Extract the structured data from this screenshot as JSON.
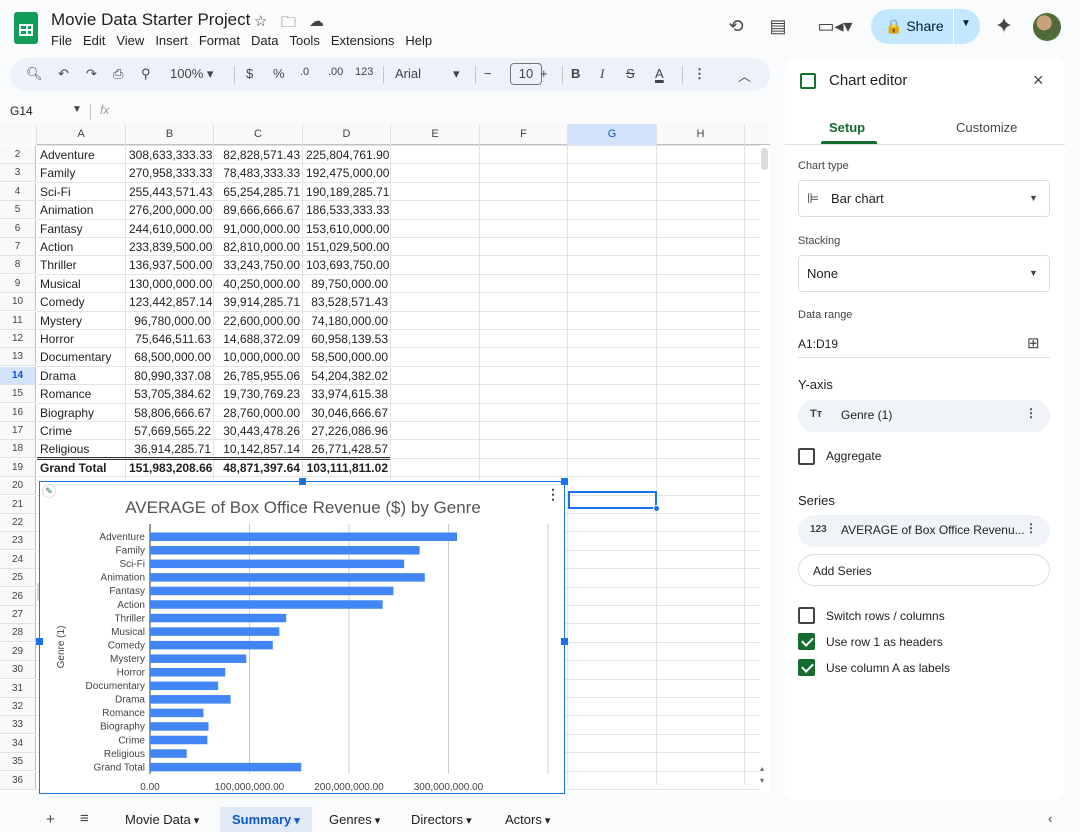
{
  "app": {
    "doc_title": "Movie Data Starter Project",
    "menu": [
      "File",
      "Edit",
      "View",
      "Insert",
      "Format",
      "Data",
      "Tools",
      "Extensions",
      "Help"
    ],
    "share_label": "Share"
  },
  "toolbar": {
    "zoom": "100%",
    "currency": "$",
    "percent": "%",
    "dec_dec": ".0",
    "dec_inc": ".00",
    "format_num": "123",
    "font": "Arial",
    "font_size": "10",
    "bold": "B",
    "italic": "I",
    "underline_a": "A"
  },
  "formula_bar": {
    "name_box": "G14",
    "fx": "fx"
  },
  "grid": {
    "columns": [
      "A",
      "B",
      "C",
      "D",
      "E",
      "F",
      "G",
      "H"
    ],
    "rows": [
      {
        "n": "2",
        "a": "Adventure",
        "b": "308,633,333.33",
        "c": "82,828,571.43",
        "d": "225,804,761.90"
      },
      {
        "n": "3",
        "a": "Family",
        "b": "270,958,333.33",
        "c": "78,483,333.33",
        "d": "192,475,000.00"
      },
      {
        "n": "4",
        "a": "Sci-Fi",
        "b": "255,443,571.43",
        "c": "65,254,285.71",
        "d": "190,189,285.71"
      },
      {
        "n": "5",
        "a": "Animation",
        "b": "276,200,000.00",
        "c": "89,666,666.67",
        "d": "186,533,333.33"
      },
      {
        "n": "6",
        "a": "Fantasy",
        "b": "244,610,000.00",
        "c": "91,000,000.00",
        "d": "153,610,000.00"
      },
      {
        "n": "7",
        "a": "Action",
        "b": "233,839,500.00",
        "c": "82,810,000.00",
        "d": "151,029,500.00"
      },
      {
        "n": "8",
        "a": "Thriller",
        "b": "136,937,500.00",
        "c": "33,243,750.00",
        "d": "103,693,750.00"
      },
      {
        "n": "9",
        "a": "Musical",
        "b": "130,000,000.00",
        "c": "40,250,000.00",
        "d": "89,750,000.00"
      },
      {
        "n": "10",
        "a": "Comedy",
        "b": "123,442,857.14",
        "c": "39,914,285.71",
        "d": "83,528,571.43"
      },
      {
        "n": "11",
        "a": "Mystery",
        "b": "96,780,000.00",
        "c": "22,600,000.00",
        "d": "74,180,000.00"
      },
      {
        "n": "12",
        "a": "Horror",
        "b": "75,646,511.63",
        "c": "14,688,372.09",
        "d": "60,958,139.53"
      },
      {
        "n": "13",
        "a": "Documentary",
        "b": "68,500,000.00",
        "c": "10,000,000.00",
        "d": "58,500,000.00"
      },
      {
        "n": "14",
        "a": "Drama",
        "b": "80,990,337.08",
        "c": "26,785,955.06",
        "d": "54,204,382.02"
      },
      {
        "n": "15",
        "a": "Romance",
        "b": "53,705,384.62",
        "c": "19,730,769.23",
        "d": "33,974,615.38"
      },
      {
        "n": "16",
        "a": "Biography",
        "b": "58,806,666.67",
        "c": "28,760,000.00",
        "d": "30,046,666.67"
      },
      {
        "n": "17",
        "a": "Crime",
        "b": "57,669,565.22",
        "c": "30,443,478.26",
        "d": "27,226,086.96"
      },
      {
        "n": "18",
        "a": "Religious",
        "b": "36,914,285.71",
        "c": "10,142,857.14",
        "d": "26,771,428.57"
      },
      {
        "n": "19",
        "a": "Grand Total",
        "b": "151,983,208.66",
        "c": "48,871,397.64",
        "d": "103,111,811.02"
      }
    ],
    "extra_rows": [
      "20",
      "21",
      "22",
      "23",
      "24",
      "25",
      "26",
      "27",
      "28",
      "29",
      "30",
      "31",
      "32",
      "33",
      "34",
      "35",
      "36"
    ]
  },
  "chart_data": {
    "type": "bar",
    "title": "AVERAGE of Box Office Revenue ($) by Genre",
    "ylabel": "Genre (1)",
    "xlabel": "",
    "categories": [
      "Adventure",
      "Family",
      "Sci-Fi",
      "Animation",
      "Fantasy",
      "Action",
      "Thriller",
      "Musical",
      "Comedy",
      "Mystery",
      "Horror",
      "Documentary",
      "Drama",
      "Romance",
      "Biography",
      "Crime",
      "Religious",
      "Grand Total"
    ],
    "values": [
      308633333.33,
      270958333.33,
      255443571.43,
      276200000.0,
      244610000.0,
      233839500.0,
      136937500.0,
      130000000.0,
      123442857.14,
      96780000.0,
      75646511.63,
      68500000.0,
      80990337.08,
      53705384.62,
      58806666.67,
      57669565.22,
      36914285.71,
      151983208.66
    ],
    "xlim": [
      0,
      400000000
    ],
    "x_ticks": [
      "0.00",
      "100,000,000.00",
      "200,000,000.00",
      "300,000,000.00"
    ],
    "grid": true,
    "bar_color": "#4285f4"
  },
  "editor": {
    "title": "Chart editor",
    "tabs": [
      "Setup",
      "Customize"
    ],
    "chart_type_label": "Chart type",
    "chart_type": "Bar chart",
    "stacking_label": "Stacking",
    "stacking": "None",
    "range_label": "Data range",
    "range": "A1:D19",
    "yaxis_label": "Y-axis",
    "yaxis_chip": "Genre (1)",
    "aggregate": "Aggregate",
    "series_label": "Series",
    "series_chip": "AVERAGE of Box Office Revenu...",
    "add_series": "Add Series",
    "switch": "Switch rows / columns",
    "row1": "Use row 1 as headers",
    "colA": "Use column A as labels"
  },
  "tabs": [
    "Movie Data",
    "Summary",
    "Genres",
    "Directors",
    "Actors"
  ],
  "active_tab": "Summary",
  "colors": {
    "accent": "#0b57d0",
    "share_bg": "#c2e7ff",
    "check": "#146c2e"
  }
}
